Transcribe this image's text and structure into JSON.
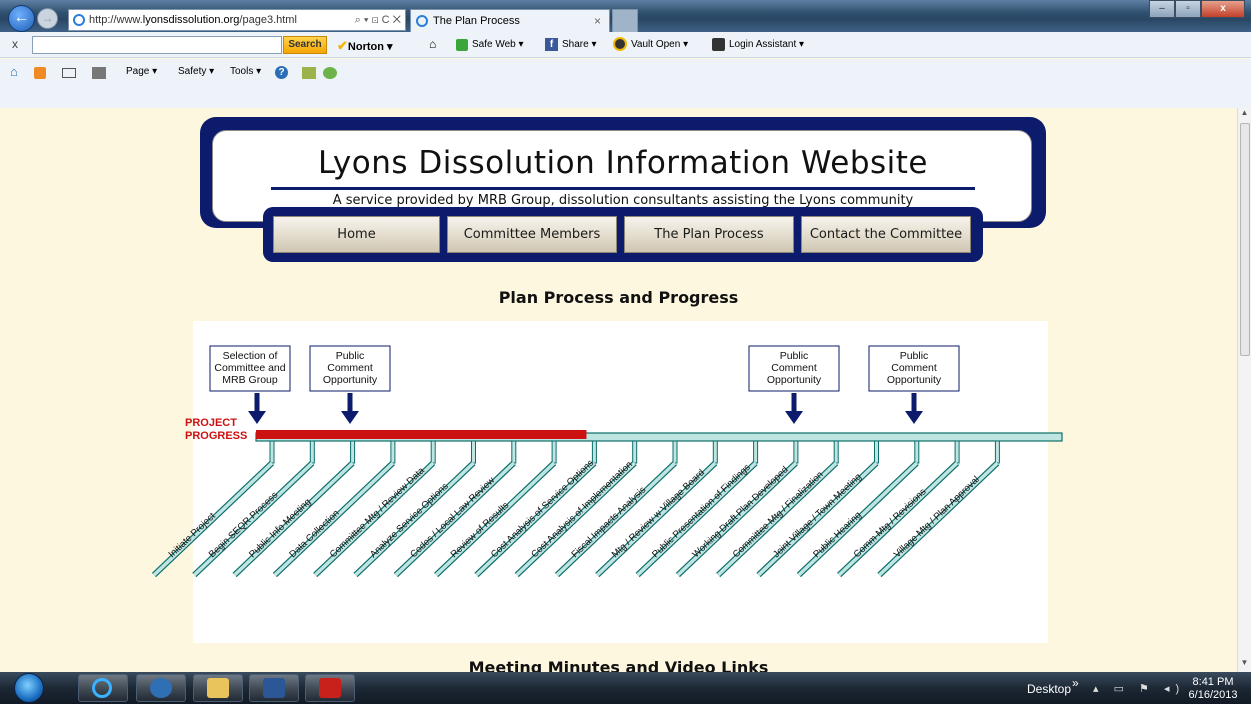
{
  "browser": {
    "url_prefix": "http://www.",
    "url_domain": "lyonsdissolution.org",
    "url_path": "/page3.html",
    "address_tools": "⌕ ▾ ⊡ C ✕",
    "tab_title": "The Plan Process",
    "tab_close": "×",
    "window_buttons": {
      "minimize": "–",
      "maximize": "▫",
      "close": "x"
    },
    "right_icons": "⌂ ☆ ⚙"
  },
  "toolbar": {
    "close_x": "x",
    "search_button": "Search",
    "norton_label": "Norton ▾",
    "safe_web": "Safe Web ▾",
    "share": "Share ▾",
    "vault": "Vault Open ▾",
    "login": "Login Assistant ▾"
  },
  "command_bar": {
    "page": "Page ▾",
    "safety": "Safety ▾",
    "tools": "Tools ▾",
    "help": "?"
  },
  "site": {
    "title": "Lyons Dissolution Information Website",
    "subtitle": "A service provided by MRB Group, dissolution consultants assisting the Lyons community",
    "nav": {
      "home": "Home",
      "committee": "Committee Members",
      "plan": "The Plan Process",
      "contact": "Contact the Committee"
    },
    "section_title": "Plan Process and Progress",
    "next_section_title": "Meeting Minutes and Video Links"
  },
  "diagram": {
    "callouts": [
      {
        "lines": [
          "Selection of",
          "Committee and",
          "MRB Group"
        ]
      },
      {
        "lines": [
          "Public",
          "Comment",
          "Opportunity"
        ]
      },
      {
        "lines": [
          "Public",
          "Comment",
          "Opportunity"
        ]
      },
      {
        "lines": [
          "Public",
          "Comment",
          "Opportunity"
        ]
      }
    ],
    "progress_label_1": "PROJECT",
    "progress_label_2": "PROGRESS",
    "progress_fraction": 0.41,
    "colors": {
      "timeline": "#bfe5e2",
      "timeline_stroke": "#0d6e6a",
      "progress": "#cc1111",
      "arrow": "#0c1b6b",
      "label": "#cc1111"
    },
    "steps": [
      "Initiate Project",
      "Begin SEQR Process",
      "Public Info Meeting",
      "Data Collection",
      "Committee Mtg / Review Data",
      "Analyze Service Options",
      "Codes / Local Law Review",
      "Review of Results",
      "Cost Analysis of Service Options",
      "Cost Analysis of Implementation",
      "Fiscal Impacts Analysis",
      "Mtg / Review w Village Board",
      "Public Presentation of Findings",
      "Working Draft Plan Developed",
      "Committee Mtg / Finalization",
      "Joint Village / Town Meeting",
      "Public Hearing",
      "Comm Mtg / Revisions",
      "Village Mtg / Plan Approval"
    ]
  },
  "taskbar": {
    "desktop": "Desktop",
    "chevron": "»",
    "tray": "▴ ▭ ⚑ ◂)",
    "time": "8:41 PM",
    "date": "6/16/2013"
  }
}
